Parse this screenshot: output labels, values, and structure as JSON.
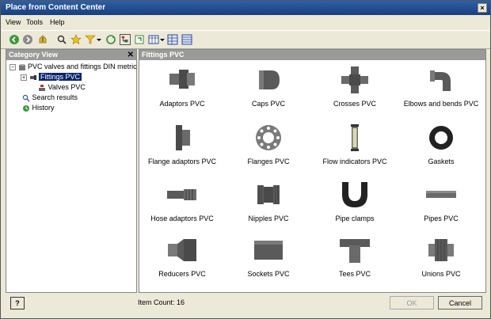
{
  "window": {
    "title": "Place from Content Center",
    "close_label": "×"
  },
  "menu": [
    "View",
    "Tools",
    "Help"
  ],
  "toolbar": [
    "back-icon",
    "forward-icon",
    "up-icon",
    "search-icon",
    "favorites-icon",
    "filter-icon",
    "dropdown-icon",
    "refresh-icon",
    "tree-view-icon",
    "swap-icon",
    "view-mode-icon",
    "dropdown-icon",
    "table-view-icon",
    "grid-view-icon"
  ],
  "left_pane": {
    "header": "Category View",
    "close_label": "✕",
    "tree": [
      {
        "label": "PVC valves and fittings DIN metric",
        "expander": "−"
      },
      {
        "label": "Fittings PVC",
        "expander": "+"
      },
      {
        "label": "Valves PVC"
      },
      {
        "label": "Search results"
      },
      {
        "label": "History"
      }
    ]
  },
  "right_pane": {
    "header": "Fittings PVC",
    "items": [
      {
        "label": "Adaptors PVC",
        "icon": "adaptor-icon"
      },
      {
        "label": "Caps PVC",
        "icon": "cap-icon"
      },
      {
        "label": "Crosses PVC",
        "icon": "cross-icon"
      },
      {
        "label": "Elbows and bends PVC",
        "icon": "elbow-icon"
      },
      {
        "label": "Flange adaptors PVC",
        "icon": "flange-adaptor-icon"
      },
      {
        "label": "Flanges PVC",
        "icon": "flange-icon"
      },
      {
        "label": "Flow indicators PVC",
        "icon": "flow-indicator-icon"
      },
      {
        "label": "Gaskets",
        "icon": "gasket-icon"
      },
      {
        "label": "Hose adaptors PVC",
        "icon": "hose-adaptor-icon"
      },
      {
        "label": "Nipples PVC",
        "icon": "nipple-icon"
      },
      {
        "label": "Pipe clamps",
        "icon": "pipe-clamp-icon"
      },
      {
        "label": "Pipes PVC",
        "icon": "pipe-icon"
      },
      {
        "label": "Reducers PVC",
        "icon": "reducer-icon"
      },
      {
        "label": "Sockets PVC",
        "icon": "socket-icon"
      },
      {
        "label": "Tees PVC",
        "icon": "tee-icon"
      },
      {
        "label": "Unions PVC",
        "icon": "union-icon"
      }
    ]
  },
  "status": {
    "help_label": "?",
    "item_count": "Item Count: 16",
    "ok_label": "OK",
    "cancel_label": "Cancel"
  },
  "colors": {
    "title_bar": "#1a3f7a",
    "pane_header": "#9a9a9a",
    "selection": "#0a246a",
    "part": "#5a5a5a"
  }
}
